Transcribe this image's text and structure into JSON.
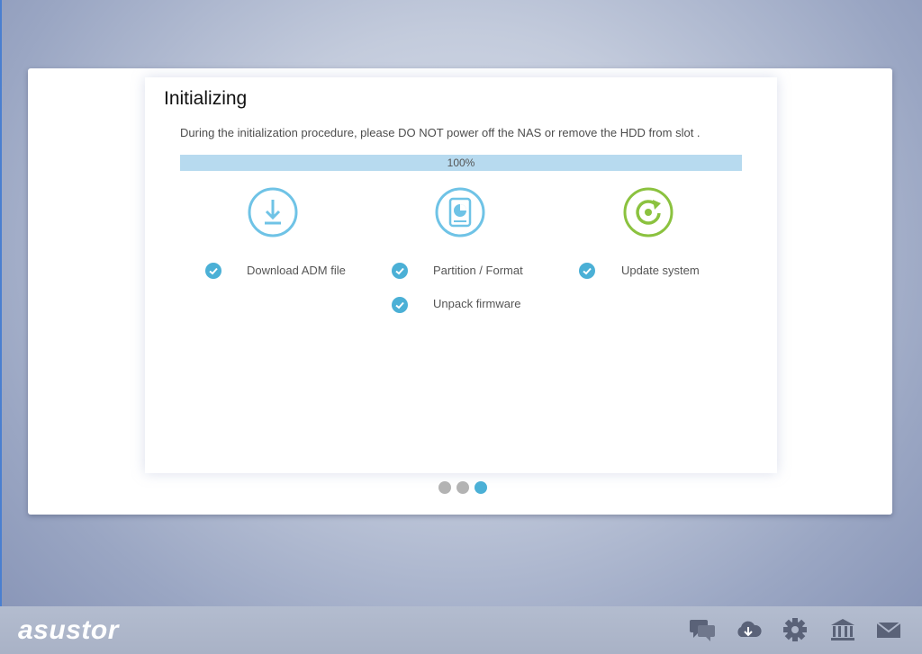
{
  "wizard": {
    "title": "Initializing",
    "description": "During the initialization procedure, please DO NOT power off the NAS or remove the HDD from slot .",
    "progress": {
      "percent": 100,
      "label": "100%"
    }
  },
  "steps": [
    {
      "label": "Download ADM file",
      "icon": "download-icon",
      "status": "done"
    },
    {
      "label": "Partition / Format",
      "icon": "hard-disk-icon",
      "status": "done"
    },
    {
      "label": "Unpack firmware",
      "icon": null,
      "status": "done"
    },
    {
      "label": "Update system",
      "icon": "refresh-icon",
      "status": "done"
    }
  ],
  "pagination": {
    "pages": 3,
    "current": 3
  },
  "footer": {
    "logo": "asustor",
    "icons": [
      "chat-icon",
      "cloud-icon",
      "gear-icon",
      "bank-icon",
      "mail-icon"
    ]
  },
  "colors": {
    "accent": "#4bb0d6",
    "icon_blue": "#6fc3e6",
    "icon_green": "#8bc23f",
    "progress_bg": "#c4e1f2",
    "page_background": "#9aa6c3"
  }
}
